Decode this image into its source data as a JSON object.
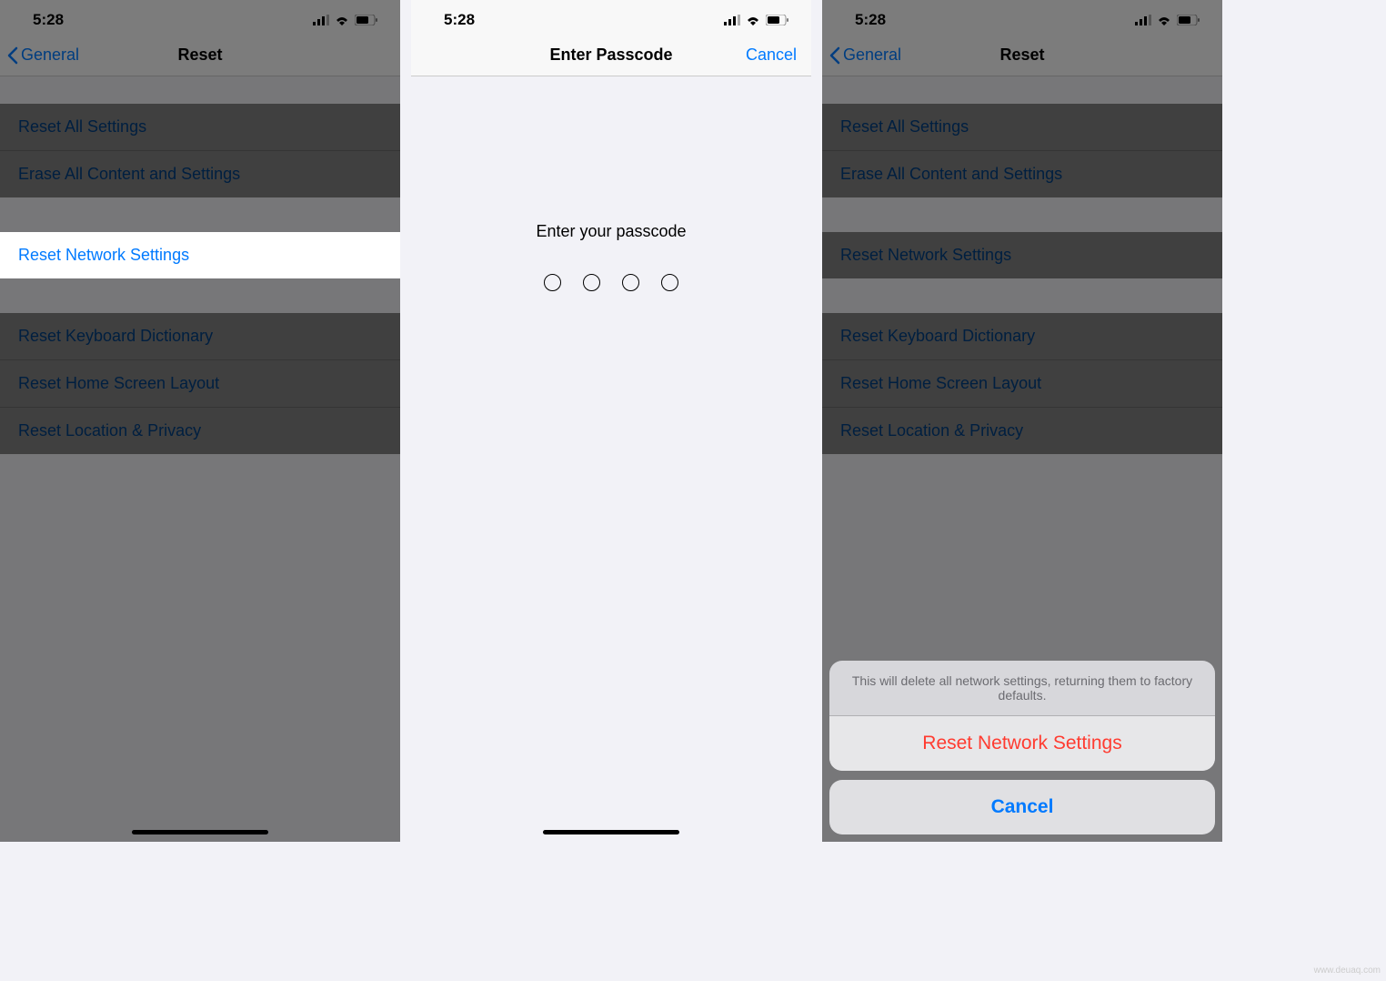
{
  "status": {
    "time": "5:28"
  },
  "panel1": {
    "back": "General",
    "title": "Reset",
    "group1": [
      "Reset All Settings",
      "Erase All Content and Settings"
    ],
    "highlighted": "Reset Network Settings",
    "group2": [
      "Reset Keyboard Dictionary",
      "Reset Home Screen Layout",
      "Reset Location & Privacy"
    ]
  },
  "panel2": {
    "title": "Enter Passcode",
    "cancel": "Cancel",
    "prompt": "Enter your passcode"
  },
  "panel3": {
    "back": "General",
    "title": "Reset",
    "group1": [
      "Reset All Settings",
      "Erase All Content and Settings"
    ],
    "group1b": [
      "Reset Network Settings"
    ],
    "group2": [
      "Reset Keyboard Dictionary",
      "Reset Home Screen Layout",
      "Reset Location & Privacy"
    ],
    "sheet": {
      "header": "This will delete all network settings, returning them to factory defaults.",
      "destructive": "Reset Network Settings",
      "cancel": "Cancel"
    }
  },
  "watermark": "www.deuaq.com"
}
